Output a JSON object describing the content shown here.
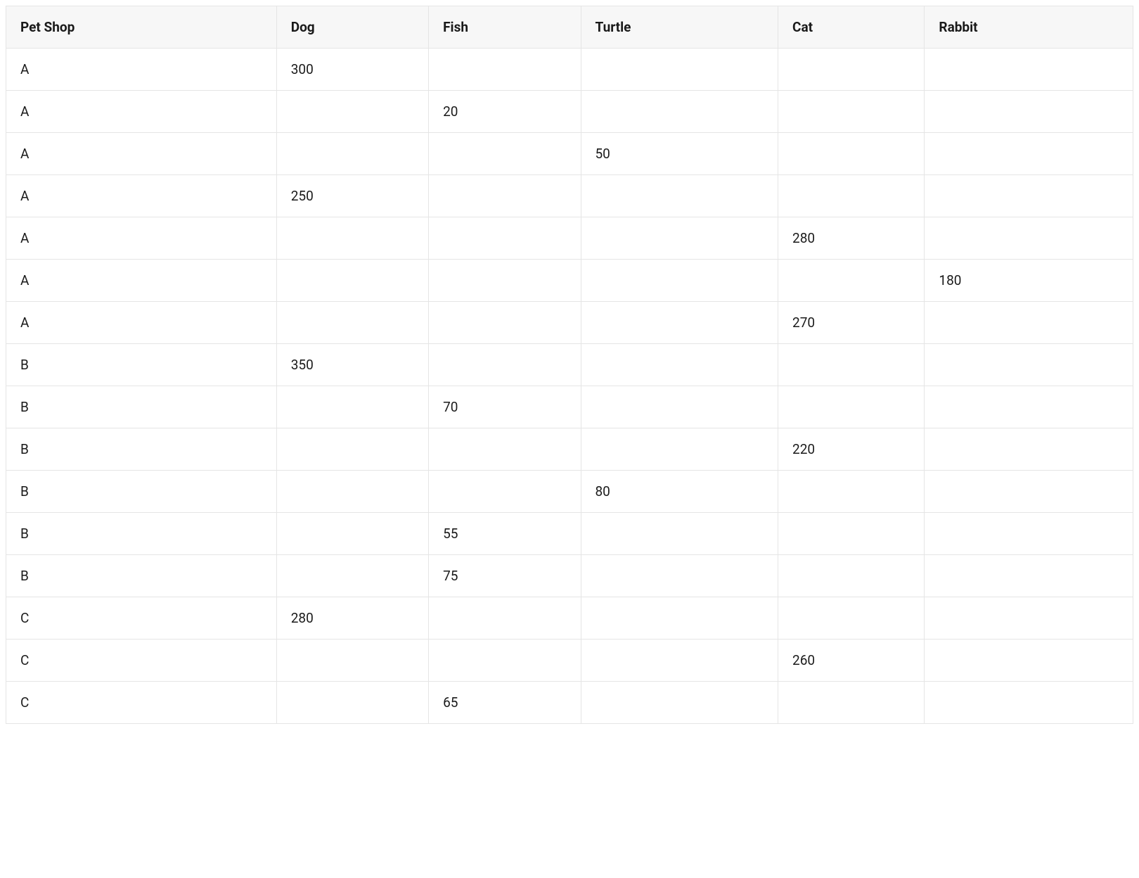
{
  "table": {
    "headers": [
      "Pet Shop",
      "Dog",
      "Fish",
      "Turtle",
      "Cat",
      "Rabbit"
    ],
    "rows": [
      [
        "A",
        "300",
        "",
        "",
        "",
        ""
      ],
      [
        "A",
        "",
        "20",
        "",
        "",
        ""
      ],
      [
        "A",
        "",
        "",
        "50",
        "",
        ""
      ],
      [
        "A",
        "250",
        "",
        "",
        "",
        ""
      ],
      [
        "A",
        "",
        "",
        "",
        "280",
        ""
      ],
      [
        "A",
        "",
        "",
        "",
        "",
        "180"
      ],
      [
        "A",
        "",
        "",
        "",
        "270",
        ""
      ],
      [
        "B",
        "350",
        "",
        "",
        "",
        ""
      ],
      [
        "B",
        "",
        "70",
        "",
        "",
        ""
      ],
      [
        "B",
        "",
        "",
        "",
        "220",
        ""
      ],
      [
        "B",
        "",
        "",
        "80",
        "",
        ""
      ],
      [
        "B",
        "",
        "55",
        "",
        "",
        ""
      ],
      [
        "B",
        "",
        "75",
        "",
        "",
        ""
      ],
      [
        "C",
        "280",
        "",
        "",
        "",
        ""
      ],
      [
        "C",
        "",
        "",
        "",
        "260",
        ""
      ],
      [
        "C",
        "",
        "65",
        "",
        "",
        ""
      ]
    ]
  },
  "chart_data": {
    "type": "table",
    "title": "",
    "columns": [
      "Pet Shop",
      "Dog",
      "Fish",
      "Turtle",
      "Cat",
      "Rabbit"
    ],
    "data": [
      {
        "Pet Shop": "A",
        "Dog": 300,
        "Fish": null,
        "Turtle": null,
        "Cat": null,
        "Rabbit": null
      },
      {
        "Pet Shop": "A",
        "Dog": null,
        "Fish": 20,
        "Turtle": null,
        "Cat": null,
        "Rabbit": null
      },
      {
        "Pet Shop": "A",
        "Dog": null,
        "Fish": null,
        "Turtle": 50,
        "Cat": null,
        "Rabbit": null
      },
      {
        "Pet Shop": "A",
        "Dog": 250,
        "Fish": null,
        "Turtle": null,
        "Cat": null,
        "Rabbit": null
      },
      {
        "Pet Shop": "A",
        "Dog": null,
        "Fish": null,
        "Turtle": null,
        "Cat": 280,
        "Rabbit": null
      },
      {
        "Pet Shop": "A",
        "Dog": null,
        "Fish": null,
        "Turtle": null,
        "Cat": null,
        "Rabbit": 180
      },
      {
        "Pet Shop": "A",
        "Dog": null,
        "Fish": null,
        "Turtle": null,
        "Cat": 270,
        "Rabbit": null
      },
      {
        "Pet Shop": "B",
        "Dog": 350,
        "Fish": null,
        "Turtle": null,
        "Cat": null,
        "Rabbit": null
      },
      {
        "Pet Shop": "B",
        "Dog": null,
        "Fish": 70,
        "Turtle": null,
        "Cat": null,
        "Rabbit": null
      },
      {
        "Pet Shop": "B",
        "Dog": null,
        "Fish": null,
        "Turtle": null,
        "Cat": 220,
        "Rabbit": null
      },
      {
        "Pet Shop": "B",
        "Dog": null,
        "Fish": null,
        "Turtle": 80,
        "Cat": null,
        "Rabbit": null
      },
      {
        "Pet Shop": "B",
        "Dog": null,
        "Fish": 55,
        "Turtle": null,
        "Cat": null,
        "Rabbit": null
      },
      {
        "Pet Shop": "B",
        "Dog": null,
        "Fish": 75,
        "Turtle": null,
        "Cat": null,
        "Rabbit": null
      },
      {
        "Pet Shop": "C",
        "Dog": 280,
        "Fish": null,
        "Turtle": null,
        "Cat": null,
        "Rabbit": null
      },
      {
        "Pet Shop": "C",
        "Dog": null,
        "Fish": null,
        "Turtle": null,
        "Cat": 260,
        "Rabbit": null
      },
      {
        "Pet Shop": "C",
        "Dog": null,
        "Fish": 65,
        "Turtle": null,
        "Cat": null,
        "Rabbit": null
      }
    ]
  }
}
